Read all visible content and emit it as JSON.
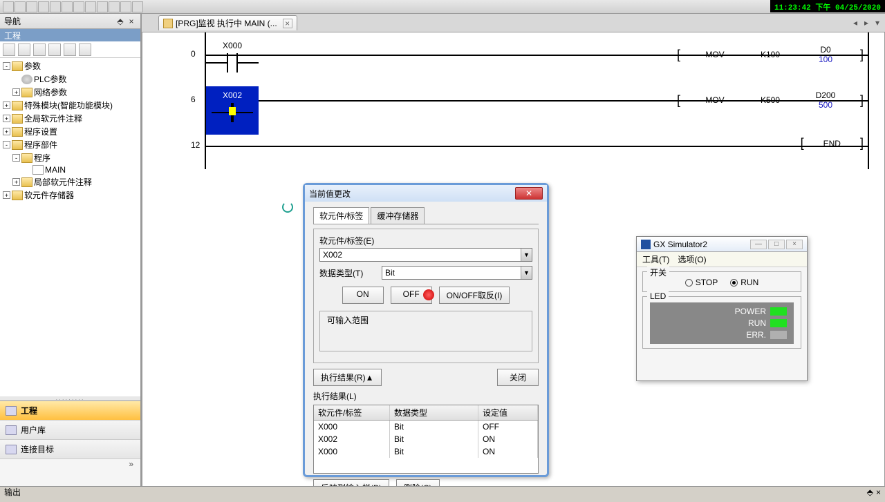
{
  "timestamp": "11:23:42 下午 04/25/2020",
  "nav": {
    "title": "导航",
    "project_band": "工程",
    "tree": [
      {
        "label": "参数",
        "indent": 0,
        "icon": "folder",
        "expand": "-"
      },
      {
        "label": "PLC参数",
        "indent": 1,
        "icon": "gear"
      },
      {
        "label": "网络参数",
        "indent": 1,
        "icon": "folder",
        "expand": "+"
      },
      {
        "label": "特殊模块(智能功能模块)",
        "indent": 0,
        "icon": "folder",
        "expand": "+"
      },
      {
        "label": "全局软元件注释",
        "indent": 0,
        "icon": "folder",
        "expand": "+"
      },
      {
        "label": "程序设置",
        "indent": 0,
        "icon": "folder",
        "expand": "+"
      },
      {
        "label": "程序部件",
        "indent": 0,
        "icon": "folder",
        "expand": "-"
      },
      {
        "label": "程序",
        "indent": 1,
        "icon": "folder",
        "expand": "-"
      },
      {
        "label": "MAIN",
        "indent": 2,
        "icon": "file"
      },
      {
        "label": "局部软元件注释",
        "indent": 1,
        "icon": "folder",
        "expand": "+"
      },
      {
        "label": "软元件存储器",
        "indent": 0,
        "icon": "folder",
        "expand": "+"
      }
    ],
    "bottom_tabs": [
      {
        "label": "工程",
        "active": true
      },
      {
        "label": "用户库",
        "active": false
      },
      {
        "label": "连接目标",
        "active": false
      }
    ]
  },
  "doc_tab": {
    "title": "[PRG]监视 执行中 MAIN (..."
  },
  "ladder": {
    "rungs": [
      {
        "num": "0",
        "contact": "X000",
        "out": [
          "MOV",
          "K100",
          "D0"
        ],
        "val": "100"
      },
      {
        "num": "6",
        "contact": "X002",
        "out": [
          "MOV",
          "K500",
          "D200"
        ],
        "val": "500",
        "selected": true
      },
      {
        "num": "12",
        "end": "END"
      }
    ]
  },
  "dlg1": {
    "title": "当前值更改",
    "tabs": [
      "软元件/标签",
      "缓冲存储器"
    ],
    "device_label": "软元件/标签(E)",
    "device_value": "X002",
    "type_label": "数据类型(T)",
    "type_value": "Bit",
    "btn_on": "ON",
    "btn_off": "OFF",
    "btn_toggle": "ON/OFF取反(I)",
    "range_legend": "可输入范围",
    "result_toggle": "执行结果(R)▲",
    "btn_close": "关闭",
    "result_label": "执行结果(L)",
    "table_headers": [
      "软元件/标签",
      "数据类型",
      "设定值"
    ],
    "table_rows": [
      [
        "X000",
        "Bit",
        "OFF"
      ],
      [
        "X002",
        "Bit",
        "ON"
      ],
      [
        "X000",
        "Bit",
        "ON"
      ]
    ],
    "btn_reflect": "反映到输入栏(B)",
    "btn_delete": "删除(C)"
  },
  "sim": {
    "title": "GX Simulator2",
    "menu": [
      "工具(T)",
      "选项(O)"
    ],
    "switch_legend": "开关",
    "stop": "STOP",
    "run": "RUN",
    "led_legend": "LED",
    "leds": [
      {
        "label": "POWER",
        "on": true
      },
      {
        "label": "RUN",
        "on": true
      },
      {
        "label": "ERR.",
        "on": false
      }
    ]
  },
  "output_bar": "输出"
}
